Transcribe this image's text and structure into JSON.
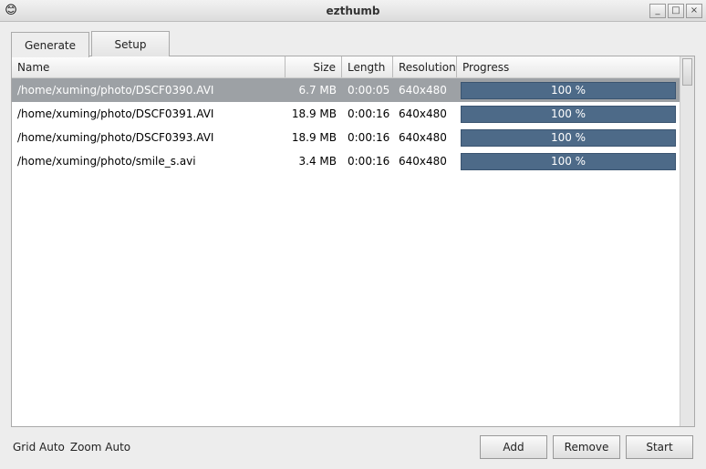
{
  "window": {
    "title": "ezthumb"
  },
  "tabs": {
    "generate": "Generate",
    "setup": "Setup",
    "active": "generate"
  },
  "columns": {
    "name": "Name",
    "size": "Size",
    "length": "Length",
    "resolution": "Resolution",
    "progress": "Progress"
  },
  "rows": [
    {
      "name": "/home/xuming/photo/DSCF0390.AVI",
      "size": "6.7 MB",
      "length": "0:00:05",
      "resolution": "640x480",
      "progress": "100 %",
      "selected": true
    },
    {
      "name": "/home/xuming/photo/DSCF0391.AVI",
      "size": "18.9 MB",
      "length": "0:00:16",
      "resolution": "640x480",
      "progress": "100 %",
      "selected": false
    },
    {
      "name": "/home/xuming/photo/DSCF0393.AVI",
      "size": "18.9 MB",
      "length": "0:00:16",
      "resolution": "640x480",
      "progress": "100 %",
      "selected": false
    },
    {
      "name": "/home/xuming/photo/smile_s.avi",
      "size": "3.4 MB",
      "length": "0:00:16",
      "resolution": "640x480",
      "progress": "100 %",
      "selected": false
    }
  ],
  "status": {
    "grid": "Grid Auto",
    "zoom": "Zoom Auto"
  },
  "buttons": {
    "add": "Add",
    "remove": "Remove",
    "start": "Start"
  }
}
